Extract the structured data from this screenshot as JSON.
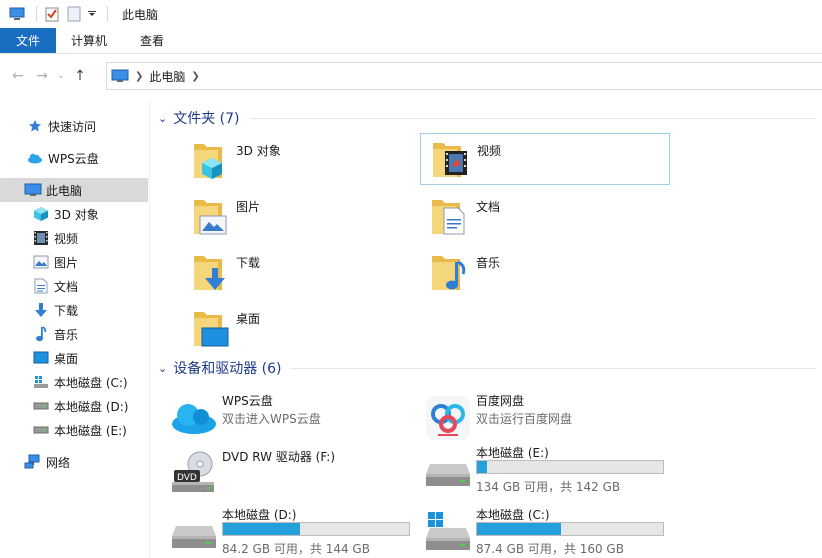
{
  "window": {
    "title": "此电脑"
  },
  "ribbon": {
    "tabs": [
      "文件",
      "计算机",
      "查看"
    ]
  },
  "address": {
    "crumb": "此电脑"
  },
  "sidebar": {
    "items": [
      {
        "label": "快速访问",
        "icon": "star-icon"
      },
      {
        "label": "WPS云盘",
        "icon": "cloud-icon"
      },
      {
        "label": "此电脑",
        "icon": "computer-icon",
        "selected": true
      },
      {
        "label": "3D 对象",
        "icon": "cube-icon"
      },
      {
        "label": "视频",
        "icon": "film-icon"
      },
      {
        "label": "图片",
        "icon": "picture-icon"
      },
      {
        "label": "文档",
        "icon": "document-icon"
      },
      {
        "label": "下载",
        "icon": "download-icon"
      },
      {
        "label": "音乐",
        "icon": "music-icon"
      },
      {
        "label": "桌面",
        "icon": "desktop-icon"
      },
      {
        "label": "本地磁盘 (C:)",
        "icon": "drive-c-icon"
      },
      {
        "label": "本地磁盘 (D:)",
        "icon": "drive-icon"
      },
      {
        "label": "本地磁盘 (E:)",
        "icon": "drive-icon"
      },
      {
        "label": "网络",
        "icon": "network-icon"
      }
    ]
  },
  "folders": {
    "header": "文件夹 (7)",
    "items": [
      {
        "label": "3D 对象",
        "icon": "folder-3d-icon"
      },
      {
        "label": "视频",
        "icon": "folder-video-icon",
        "selected": true
      },
      {
        "label": "图片",
        "icon": "folder-pictures-icon"
      },
      {
        "label": "文档",
        "icon": "folder-documents-icon"
      },
      {
        "label": "下载",
        "icon": "folder-downloads-icon"
      },
      {
        "label": "音乐",
        "icon": "folder-music-icon"
      },
      {
        "label": "桌面",
        "icon": "folder-desktop-icon"
      }
    ]
  },
  "devices": {
    "header": "设备和驱动器 (6)",
    "items": [
      {
        "name": "WPS云盘",
        "sub": "双击进入WPS云盘",
        "icon": "wps-cloud-icon"
      },
      {
        "name": "百度网盘",
        "sub": "双击运行百度网盘",
        "icon": "baidu-netdisk-icon"
      },
      {
        "name": "DVD RW 驱动器 (F:)",
        "icon": "dvd-drive-icon"
      },
      {
        "name": "本地磁盘 (E:)",
        "free": "134 GB 可用，共 142 GB",
        "used_fraction": 0.056,
        "icon": "drive-icon"
      },
      {
        "name": "本地磁盘 (D:)",
        "free": "84.2 GB 可用，共 144 GB",
        "used_fraction": 0.415,
        "icon": "drive-icon"
      },
      {
        "name": "本地磁盘 (C:)",
        "free": "87.4 GB 可用，共 160 GB",
        "used_fraction": 0.454,
        "icon": "drive-c-icon"
      }
    ]
  },
  "colors": {
    "accent": "#1a6ec2",
    "header_text": "#1e3a8a",
    "bar_fill": "#26a0da",
    "selected_bg": "#d9d9d9"
  }
}
